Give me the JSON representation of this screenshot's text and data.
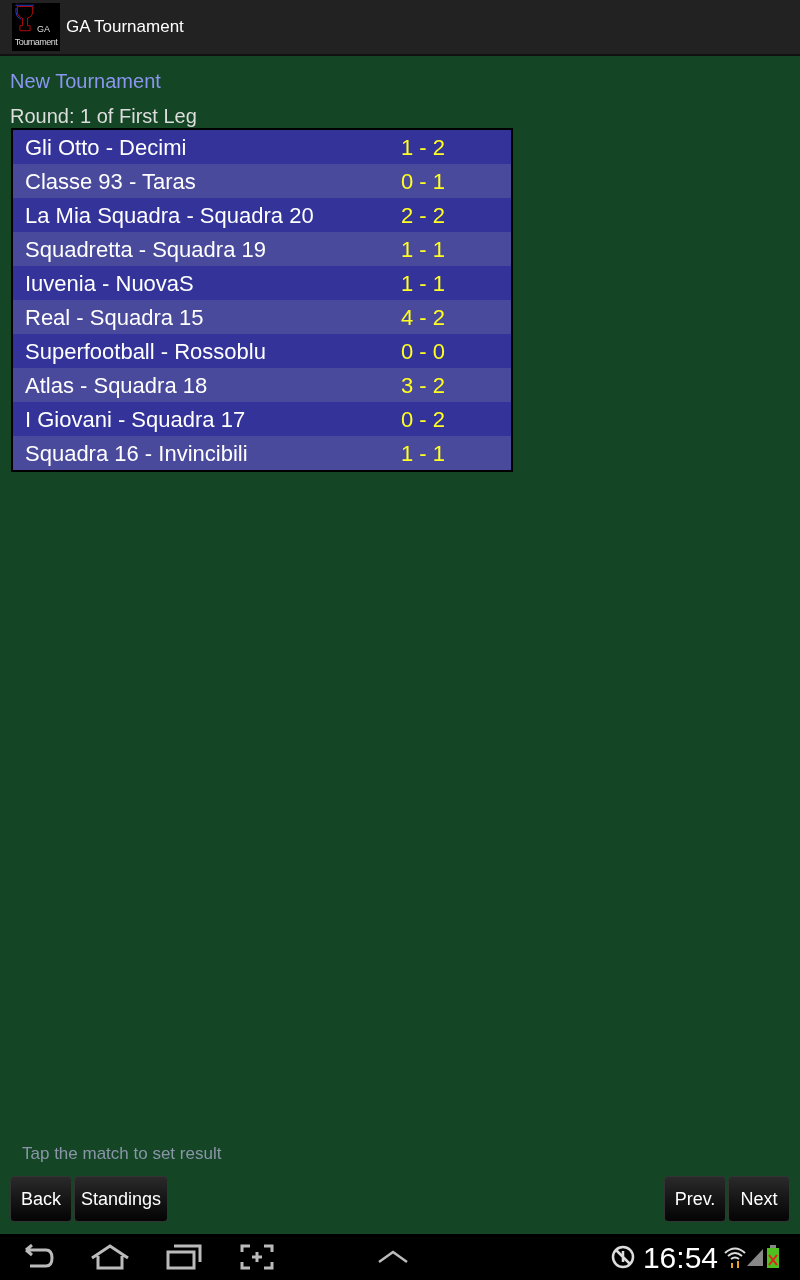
{
  "app_bar": {
    "logo_text": [
      "GA",
      "Tournament"
    ],
    "title": "GA Tournament"
  },
  "heading": "New Tournament",
  "round": "Round: 1 of First Leg",
  "matches": [
    {
      "teams": "Gli Otto - Decimi",
      "score": "1 - 2"
    },
    {
      "teams": "Classe 93 - Taras",
      "score": "0 - 1"
    },
    {
      "teams": "La Mia Squadra - Squadra 20",
      "score": "2 - 2"
    },
    {
      "teams": "Squadretta - Squadra 19",
      "score": "1 - 1"
    },
    {
      "teams": "Iuvenia - NuovaS",
      "score": "1 - 1"
    },
    {
      "teams": "Real - Squadra 15",
      "score": "4 - 2"
    },
    {
      "teams": "Superfootball - Rossoblu",
      "score": "0 - 0"
    },
    {
      "teams": "Atlas - Squadra 18",
      "score": "3 - 2"
    },
    {
      "teams": "I Giovani - Squadra 17",
      "score": "0 - 2"
    },
    {
      "teams": "Squadra 16 - Invincibili",
      "score": "1 - 1"
    }
  ],
  "hint": "Tap the match to set result",
  "left_buttons": [
    "Back",
    "Standings"
  ],
  "right_buttons": [
    "Prev.",
    "Next"
  ],
  "status_bar": {
    "time": "16:54"
  }
}
